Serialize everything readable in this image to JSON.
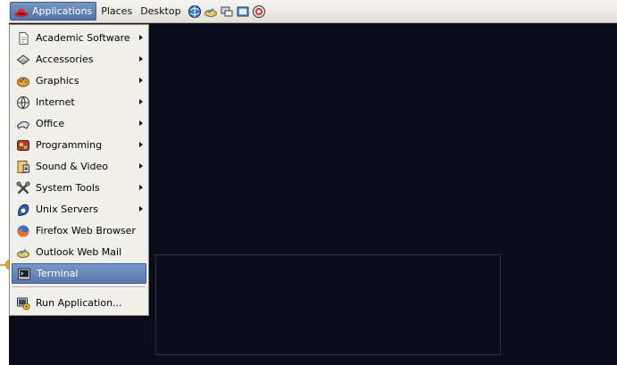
{
  "panel": {
    "menus": [
      {
        "label": "Applications",
        "icon": "redhat-icon",
        "active": true
      },
      {
        "label": "Places"
      },
      {
        "label": "Desktop"
      }
    ],
    "launchers": [
      "web-browser-icon",
      "mail-icon",
      "network-icon",
      "document-icon",
      "help-icon"
    ]
  },
  "applications_menu": {
    "items": [
      {
        "label": "Academic Software",
        "icon": "academic-icon",
        "submenu": true
      },
      {
        "label": "Accessories",
        "icon": "accessories-icon",
        "submenu": true
      },
      {
        "label": "Graphics",
        "icon": "graphics-icon",
        "submenu": true
      },
      {
        "label": "Internet",
        "icon": "internet-icon",
        "submenu": true
      },
      {
        "label": "Office",
        "icon": "office-icon",
        "submenu": true
      },
      {
        "label": "Programming",
        "icon": "programming-icon",
        "submenu": true
      },
      {
        "label": "Sound & Video",
        "icon": "sound-video-icon",
        "submenu": true
      },
      {
        "label": "System Tools",
        "icon": "system-tools-icon",
        "submenu": true
      },
      {
        "label": "Unix Servers",
        "icon": "unix-servers-icon",
        "submenu": true
      },
      {
        "label": "Firefox Web Browser",
        "icon": "firefox-icon",
        "submenu": false
      },
      {
        "label": "Outlook Web Mail",
        "icon": "web-mail-icon",
        "submenu": false
      },
      {
        "label": "Terminal",
        "icon": "terminal-icon",
        "submenu": false,
        "selected": true
      },
      {
        "label": "Run Application...",
        "icon": "run-application-icon",
        "submenu": false
      }
    ]
  },
  "colors": {
    "desktop": "#0c0d1a",
    "selection": "#5b79ad",
    "pointer": "#f0a731"
  }
}
